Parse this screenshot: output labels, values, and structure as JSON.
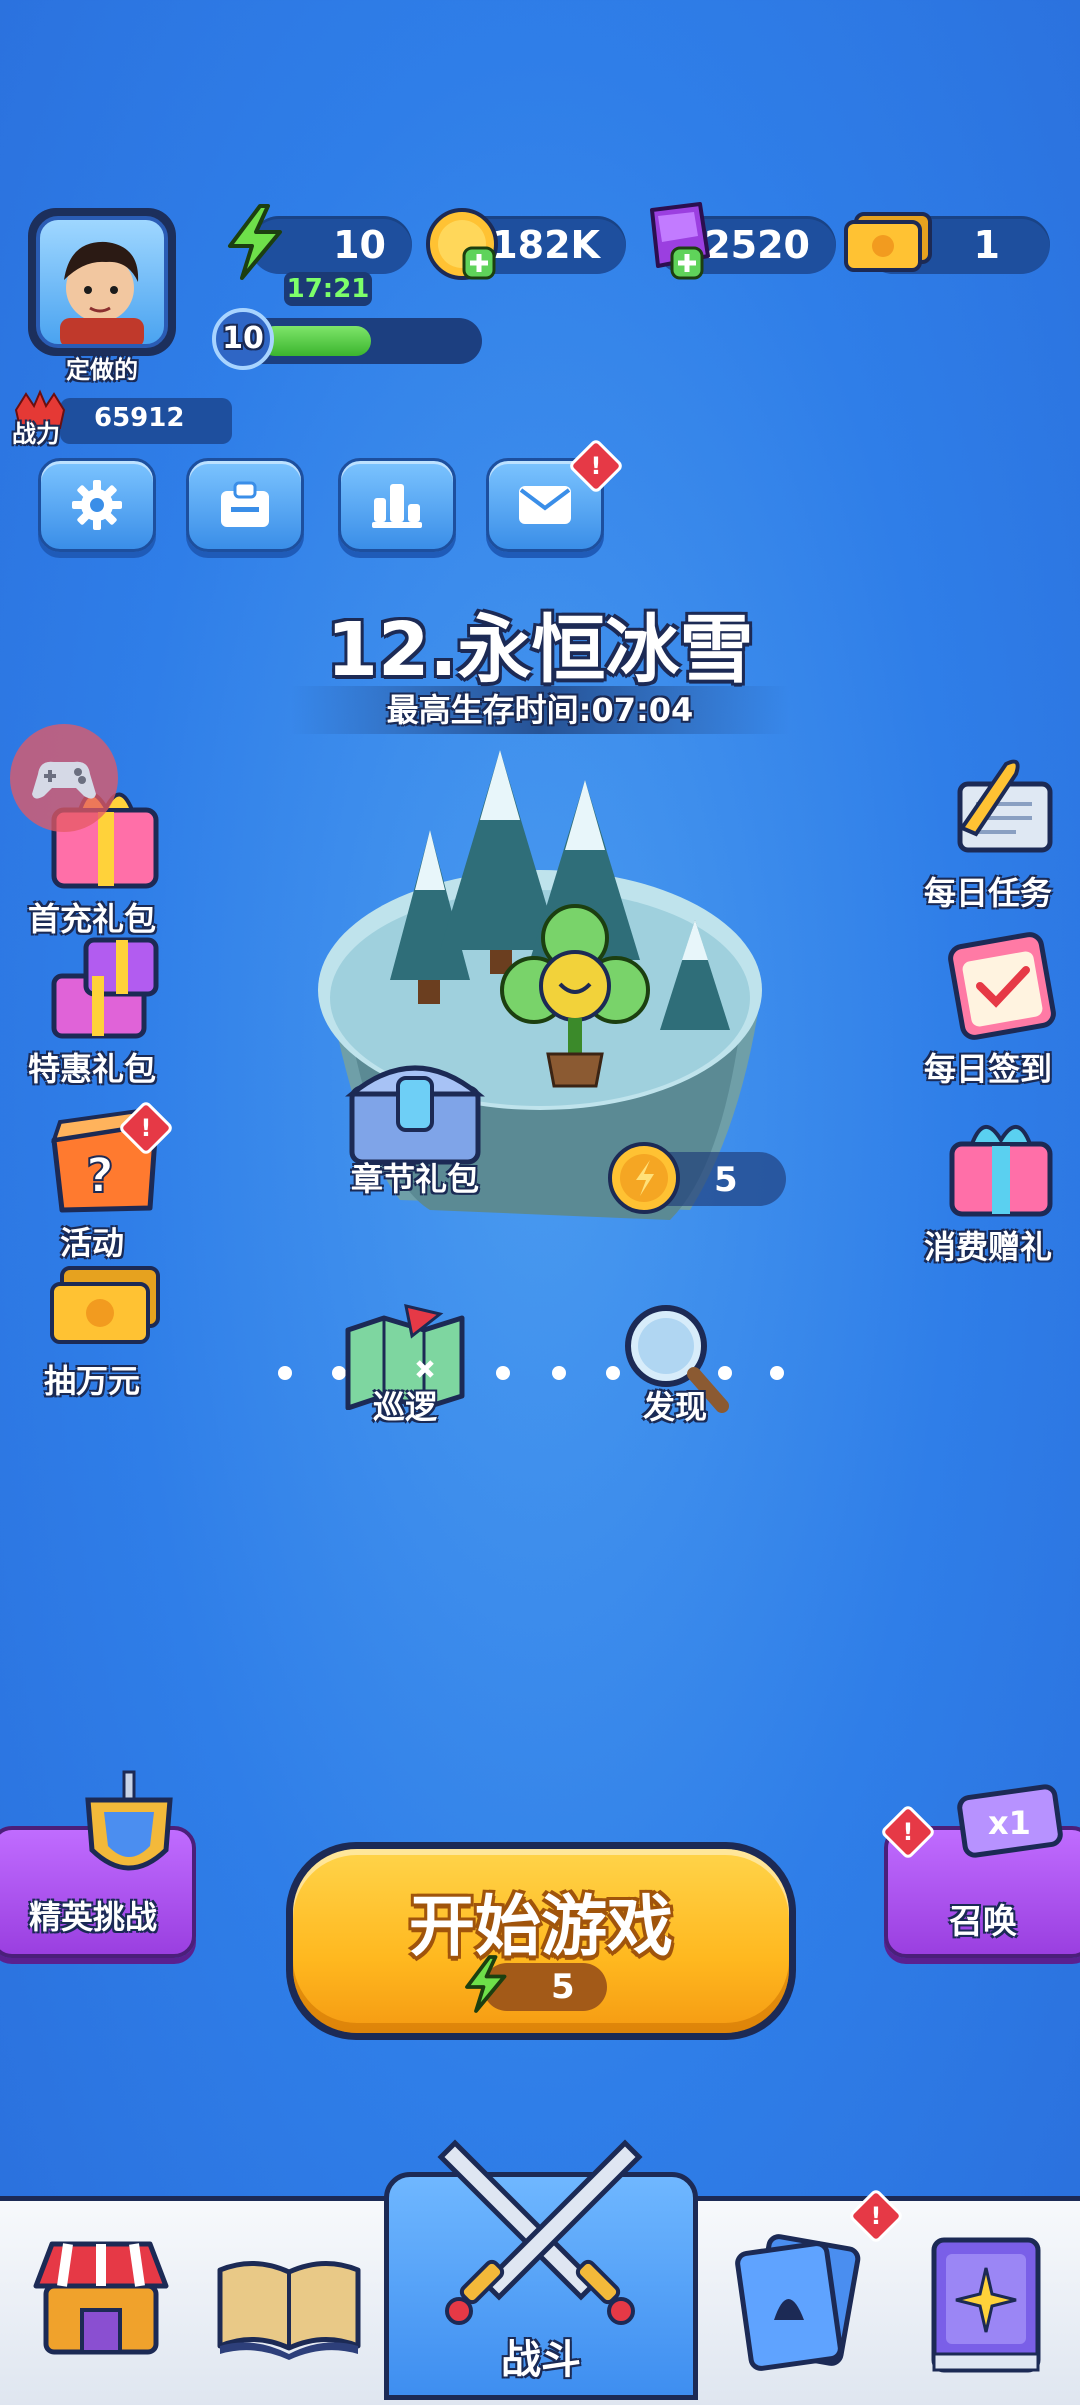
{
  "player": {
    "name": "定做的",
    "level": "10",
    "power_label": "战力",
    "power": "65912",
    "xp_fraction": 0.55
  },
  "resources": {
    "energy": "10",
    "energy_timer": "17:21",
    "coins": "182K",
    "gems": "2520",
    "tickets": "1"
  },
  "stage": {
    "title": "12.永恒冰雪",
    "best_time": "最高生存时间:07:04"
  },
  "left_menu": [
    {
      "label": "首充礼包"
    },
    {
      "label": "特惠礼包"
    },
    {
      "label": "活动"
    },
    {
      "label": "抽万元"
    }
  ],
  "right_menu": [
    {
      "label": "每日任务"
    },
    {
      "label": "每日签到"
    },
    {
      "label": "消费赠礼"
    }
  ],
  "map": {
    "chest_label": "章节礼包",
    "coin_reward": "5",
    "patrol_label": "巡逻",
    "discover_label": "发现"
  },
  "elite": {
    "label": "精英挑战"
  },
  "summon": {
    "label": "召唤"
  },
  "start": {
    "label": "开始游戏",
    "cost": "5"
  },
  "nav": {
    "battle_label": "战斗"
  },
  "badges": {
    "mark": "!"
  },
  "colors": {
    "accent_yellow": "#ffc233",
    "panel_blue": "#1e4f9e",
    "badge_red": "#e63946",
    "purple": "#a24fe0"
  }
}
